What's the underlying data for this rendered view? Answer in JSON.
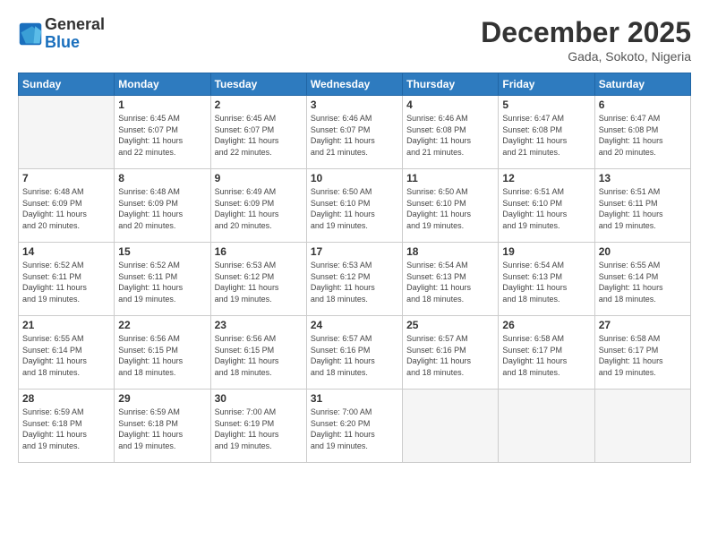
{
  "header": {
    "logo_line1": "General",
    "logo_line2": "Blue",
    "month": "December 2025",
    "location": "Gada, Sokoto, Nigeria"
  },
  "days_of_week": [
    "Sunday",
    "Monday",
    "Tuesday",
    "Wednesday",
    "Thursday",
    "Friday",
    "Saturday"
  ],
  "weeks": [
    [
      {
        "day": "",
        "text": ""
      },
      {
        "day": "1",
        "text": "Sunrise: 6:45 AM\nSunset: 6:07 PM\nDaylight: 11 hours\nand 22 minutes."
      },
      {
        "day": "2",
        "text": "Sunrise: 6:45 AM\nSunset: 6:07 PM\nDaylight: 11 hours\nand 22 minutes."
      },
      {
        "day": "3",
        "text": "Sunrise: 6:46 AM\nSunset: 6:07 PM\nDaylight: 11 hours\nand 21 minutes."
      },
      {
        "day": "4",
        "text": "Sunrise: 6:46 AM\nSunset: 6:08 PM\nDaylight: 11 hours\nand 21 minutes."
      },
      {
        "day": "5",
        "text": "Sunrise: 6:47 AM\nSunset: 6:08 PM\nDaylight: 11 hours\nand 21 minutes."
      },
      {
        "day": "6",
        "text": "Sunrise: 6:47 AM\nSunset: 6:08 PM\nDaylight: 11 hours\nand 20 minutes."
      }
    ],
    [
      {
        "day": "7",
        "text": "Sunrise: 6:48 AM\nSunset: 6:09 PM\nDaylight: 11 hours\nand 20 minutes."
      },
      {
        "day": "8",
        "text": "Sunrise: 6:48 AM\nSunset: 6:09 PM\nDaylight: 11 hours\nand 20 minutes."
      },
      {
        "day": "9",
        "text": "Sunrise: 6:49 AM\nSunset: 6:09 PM\nDaylight: 11 hours\nand 20 minutes."
      },
      {
        "day": "10",
        "text": "Sunrise: 6:50 AM\nSunset: 6:10 PM\nDaylight: 11 hours\nand 19 minutes."
      },
      {
        "day": "11",
        "text": "Sunrise: 6:50 AM\nSunset: 6:10 PM\nDaylight: 11 hours\nand 19 minutes."
      },
      {
        "day": "12",
        "text": "Sunrise: 6:51 AM\nSunset: 6:10 PM\nDaylight: 11 hours\nand 19 minutes."
      },
      {
        "day": "13",
        "text": "Sunrise: 6:51 AM\nSunset: 6:11 PM\nDaylight: 11 hours\nand 19 minutes."
      }
    ],
    [
      {
        "day": "14",
        "text": "Sunrise: 6:52 AM\nSunset: 6:11 PM\nDaylight: 11 hours\nand 19 minutes."
      },
      {
        "day": "15",
        "text": "Sunrise: 6:52 AM\nSunset: 6:11 PM\nDaylight: 11 hours\nand 19 minutes."
      },
      {
        "day": "16",
        "text": "Sunrise: 6:53 AM\nSunset: 6:12 PM\nDaylight: 11 hours\nand 19 minutes."
      },
      {
        "day": "17",
        "text": "Sunrise: 6:53 AM\nSunset: 6:12 PM\nDaylight: 11 hours\nand 18 minutes."
      },
      {
        "day": "18",
        "text": "Sunrise: 6:54 AM\nSunset: 6:13 PM\nDaylight: 11 hours\nand 18 minutes."
      },
      {
        "day": "19",
        "text": "Sunrise: 6:54 AM\nSunset: 6:13 PM\nDaylight: 11 hours\nand 18 minutes."
      },
      {
        "day": "20",
        "text": "Sunrise: 6:55 AM\nSunset: 6:14 PM\nDaylight: 11 hours\nand 18 minutes."
      }
    ],
    [
      {
        "day": "21",
        "text": "Sunrise: 6:55 AM\nSunset: 6:14 PM\nDaylight: 11 hours\nand 18 minutes."
      },
      {
        "day": "22",
        "text": "Sunrise: 6:56 AM\nSunset: 6:15 PM\nDaylight: 11 hours\nand 18 minutes."
      },
      {
        "day": "23",
        "text": "Sunrise: 6:56 AM\nSunset: 6:15 PM\nDaylight: 11 hours\nand 18 minutes."
      },
      {
        "day": "24",
        "text": "Sunrise: 6:57 AM\nSunset: 6:16 PM\nDaylight: 11 hours\nand 18 minutes."
      },
      {
        "day": "25",
        "text": "Sunrise: 6:57 AM\nSunset: 6:16 PM\nDaylight: 11 hours\nand 18 minutes."
      },
      {
        "day": "26",
        "text": "Sunrise: 6:58 AM\nSunset: 6:17 PM\nDaylight: 11 hours\nand 18 minutes."
      },
      {
        "day": "27",
        "text": "Sunrise: 6:58 AM\nSunset: 6:17 PM\nDaylight: 11 hours\nand 19 minutes."
      }
    ],
    [
      {
        "day": "28",
        "text": "Sunrise: 6:59 AM\nSunset: 6:18 PM\nDaylight: 11 hours\nand 19 minutes."
      },
      {
        "day": "29",
        "text": "Sunrise: 6:59 AM\nSunset: 6:18 PM\nDaylight: 11 hours\nand 19 minutes."
      },
      {
        "day": "30",
        "text": "Sunrise: 7:00 AM\nSunset: 6:19 PM\nDaylight: 11 hours\nand 19 minutes."
      },
      {
        "day": "31",
        "text": "Sunrise: 7:00 AM\nSunset: 6:20 PM\nDaylight: 11 hours\nand 19 minutes."
      },
      {
        "day": "",
        "text": ""
      },
      {
        "day": "",
        "text": ""
      },
      {
        "day": "",
        "text": ""
      }
    ]
  ]
}
